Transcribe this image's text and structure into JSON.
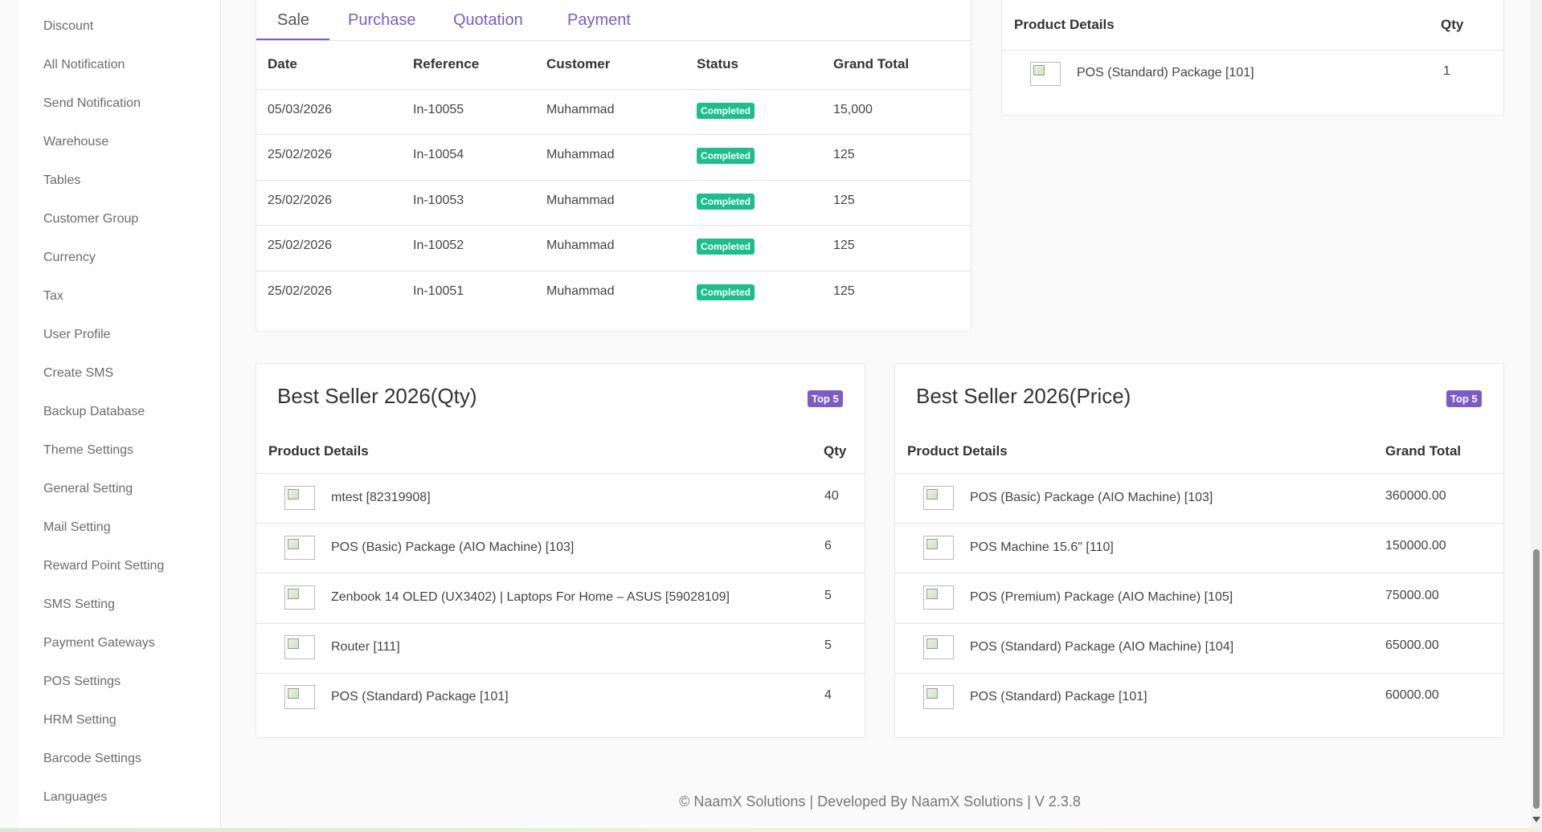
{
  "sidebar": {
    "items": [
      "Discount",
      "All Notification",
      "Send Notification",
      "Warehouse",
      "Tables",
      "Customer Group",
      "Currency",
      "Tax",
      "User Profile",
      "Create SMS",
      "Backup Database",
      "Theme Settings",
      "General Setting",
      "Mail Setting",
      "Reward Point Setting",
      "SMS Setting",
      "Payment Gateways",
      "POS Settings",
      "HRM Setting",
      "Barcode Settings",
      "Languages"
    ]
  },
  "transactions": {
    "tabs": [
      "Sale",
      "Purchase",
      "Quotation",
      "Payment"
    ],
    "active_tab": "Sale",
    "headers": [
      "Date",
      "Reference",
      "Customer",
      "Status",
      "Grand Total"
    ],
    "rows": [
      {
        "date": "05/03/2026",
        "reference": "In-10055",
        "customer": "Muhammad",
        "status": "Completed",
        "total": "15,000"
      },
      {
        "date": "25/02/2026",
        "reference": "In-10054",
        "customer": "Muhammad",
        "status": "Completed",
        "total": "125"
      },
      {
        "date": "25/02/2026",
        "reference": "In-10053",
        "customer": "Muhammad",
        "status": "Completed",
        "total": "125"
      },
      {
        "date": "25/02/2026",
        "reference": "In-10052",
        "customer": "Muhammad",
        "status": "Completed",
        "total": "125"
      },
      {
        "date": "25/02/2026",
        "reference": "In-10051",
        "customer": "Muhammad",
        "status": "Completed",
        "total": "125"
      }
    ]
  },
  "recent_products": {
    "headers": [
      "Product Details",
      "Qty"
    ],
    "rows": [
      {
        "name": "POS (Standard) Package [101]",
        "qty": "1"
      }
    ]
  },
  "best_qty": {
    "title": "Best Seller 2026(Qty)",
    "badge": "Top 5",
    "headers": [
      "Product Details",
      "Qty"
    ],
    "rows": [
      {
        "name": "mtest [82319908]",
        "value": "40"
      },
      {
        "name": "POS (Basic) Package (AIO Machine) [103]",
        "value": "6"
      },
      {
        "name": "Zenbook 14 OLED (UX3402) | Laptops For Home – ASUS [59028109]",
        "value": "5"
      },
      {
        "name": "Router [111]",
        "value": "5"
      },
      {
        "name": "POS (Standard) Package [101]",
        "value": "4"
      }
    ]
  },
  "best_price": {
    "title": "Best Seller 2026(Price)",
    "badge": "Top 5",
    "headers": [
      "Product Details",
      "Grand Total"
    ],
    "rows": [
      {
        "name": "POS (Basic) Package (AIO Machine) [103]",
        "value": "360000.00"
      },
      {
        "name": "POS Machine 15.6\" [110]",
        "value": "150000.00"
      },
      {
        "name": "POS (Premium) Package (AIO Machine) [105]",
        "value": "75000.00"
      },
      {
        "name": "POS (Standard) Package (AIO Machine) [104]",
        "value": "65000.00"
      },
      {
        "name": "POS (Standard) Package [101]",
        "value": "60000.00"
      }
    ]
  },
  "footer": {
    "text": "© NaamX Solutions | Developed By NaamX Solutions | V 2.3.8"
  },
  "colors": {
    "accent": "#7c5cc4",
    "success": "#1bbf8c"
  }
}
